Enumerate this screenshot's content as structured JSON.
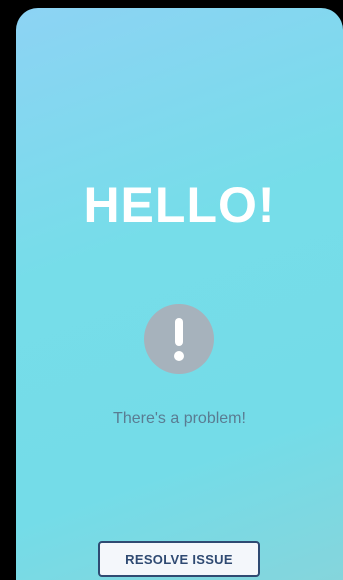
{
  "screen": {
    "greeting": "HELLO!",
    "message": "There's a problem!",
    "resolve_button_label": "RESOLVE ISSUE",
    "icon": "exclamation-alert-icon"
  },
  "colors": {
    "background_gradient_start": "#8dd3f4",
    "background_gradient_end": "#85d5dc",
    "greeting_text": "#ffffff",
    "icon_circle": "#a6b2bc",
    "message_text": "#5a7c92",
    "button_border": "#2f4a72",
    "button_background": "#f4f7fb"
  }
}
